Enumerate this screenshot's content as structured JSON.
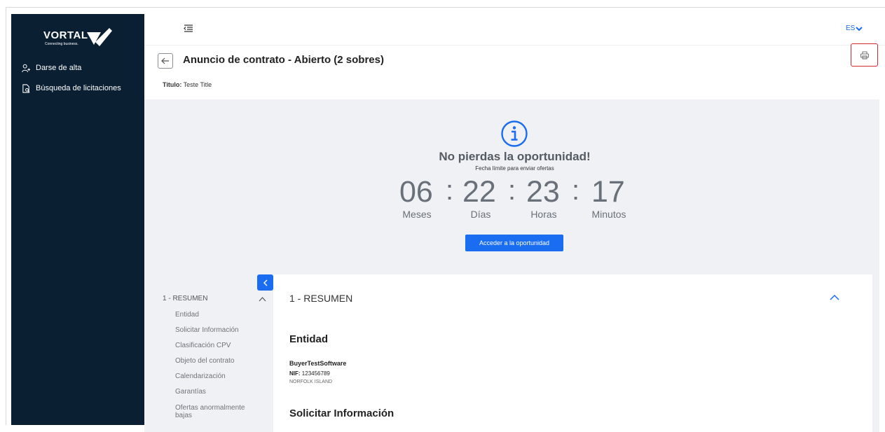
{
  "sidebar": {
    "logo_text": "VORTAL",
    "logo_tagline": "Connecting business.",
    "items": [
      {
        "label": "Darse de alta",
        "icon": "user-add-icon"
      },
      {
        "label": "Búsqueda de licitaciones",
        "icon": "document-search-icon"
      }
    ]
  },
  "topbar": {
    "language": "ES"
  },
  "header": {
    "title": "Anuncio de contrato - Abierto (2 sobres)",
    "subtitle_label": "Titulo:",
    "subtitle_value": "Teste Title"
  },
  "hero": {
    "title": "No pierdas la oportunidad!",
    "subtitle": "Fecha límite para enviar ofertas",
    "countdown": [
      {
        "value": "06",
        "label": "Meses"
      },
      {
        "value": "22",
        "label": "Días"
      },
      {
        "value": "23",
        "label": "Horas"
      },
      {
        "value": "17",
        "label": "Minutos"
      }
    ],
    "separator": ":",
    "cta_label": "Acceder a la oportunidad"
  },
  "toc": {
    "section": "1 - RESUMEN",
    "items": [
      "Entidad",
      "Solicitar Información",
      "Clasificación CPV",
      "Objeto del contrato",
      "Calendarización",
      "Garantías",
      "Ofertas anormalmente bajas"
    ]
  },
  "content": {
    "section": "1 - RESUMEN",
    "entidad_title": "Entidad",
    "entity_name": "BuyerTestSoftware",
    "nif_label": "NIF:",
    "nif_value": "123456789",
    "country": "NORFOLK ISLAND",
    "solicitar_title": "Solicitar Información"
  },
  "colors": {
    "sidebar_bg": "#0b1f33",
    "accent": "#1a6cf0",
    "hero_bg": "#eff1f4",
    "highlight_border": "#d9262c"
  }
}
